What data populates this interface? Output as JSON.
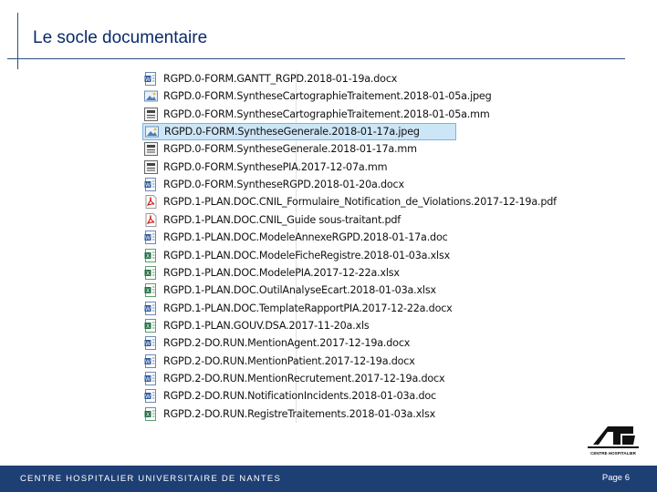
{
  "slide": {
    "title": "Le socle documentaire",
    "footer": "CENTRE HOSPITALIER UNIVERSITAIRE DE NANTES",
    "page_label": "Page 6",
    "logo_label": "CENTRE HOSPITALIER"
  },
  "files": [
    {
      "name": "RGPD.0-FORM.GANTT_RGPD.2018-01-19a.docx",
      "icon": "word-icon"
    },
    {
      "name": "RGPD.0-FORM.SyntheseCartographieTraitement.2018-01-05a.jpeg",
      "icon": "image-icon"
    },
    {
      "name": "RGPD.0-FORM.SyntheseCartographieTraitement.2018-01-05a.mm",
      "icon": "mindmap-icon"
    },
    {
      "name": "RGPD.0-FORM.SyntheseGenerale.2018-01-17a.jpeg",
      "icon": "image-icon",
      "selected": true
    },
    {
      "name": "RGPD.0-FORM.SyntheseGenerale.2018-01-17a.mm",
      "icon": "mindmap-icon"
    },
    {
      "name": "RGPD.0-FORM.SynthesePIA.2017-12-07a.mm",
      "icon": "mindmap-icon"
    },
    {
      "name": "RGPD.0-FORM.SyntheseRGPD.2018-01-20a.docx",
      "icon": "word-icon"
    },
    {
      "name": "RGPD.1-PLAN.DOC.CNIL_Formulaire_Notification_de_Violations.2017-12-19a.pdf",
      "icon": "pdf-icon"
    },
    {
      "name": "RGPD.1-PLAN.DOC.CNIL_Guide sous-traitant.pdf",
      "icon": "pdf-icon"
    },
    {
      "name": "RGPD.1-PLAN.DOC.ModeleAnnexeRGPD.2018-01-17a.doc",
      "icon": "word-icon"
    },
    {
      "name": "RGPD.1-PLAN.DOC.ModeleFicheRegistre.2018-01-03a.xlsx",
      "icon": "excel-icon"
    },
    {
      "name": "RGPD.1-PLAN.DOC.ModelePIA.2017-12-22a.xlsx",
      "icon": "excel-icon"
    },
    {
      "name": "RGPD.1-PLAN.DOC.OutilAnalyseEcart.2018-01-03a.xlsx",
      "icon": "excel-icon"
    },
    {
      "name": "RGPD.1-PLAN.DOC.TemplateRapportPIA.2017-12-22a.docx",
      "icon": "word-icon"
    },
    {
      "name": "RGPD.1-PLAN.GOUV.DSA.2017-11-20a.xls",
      "icon": "excel-icon"
    },
    {
      "name": "RGPD.2-DO.RUN.MentionAgent.2017-12-19a.docx",
      "icon": "word-icon"
    },
    {
      "name": "RGPD.2-DO.RUN.MentionPatient.2017-12-19a.docx",
      "icon": "word-icon"
    },
    {
      "name": "RGPD.2-DO.RUN.MentionRecrutement.2017-12-19a.docx",
      "icon": "word-icon"
    },
    {
      "name": "RGPD.2-DO.RUN.NotificationIncidents.2018-01-03a.doc",
      "icon": "word-icon"
    },
    {
      "name": "RGPD.2-DO.RUN.RegistreTraitements.2018-01-03a.xlsx",
      "icon": "excel-icon"
    }
  ],
  "colors": {
    "accent": "#1e3f74",
    "selection": "#cde6f7"
  }
}
